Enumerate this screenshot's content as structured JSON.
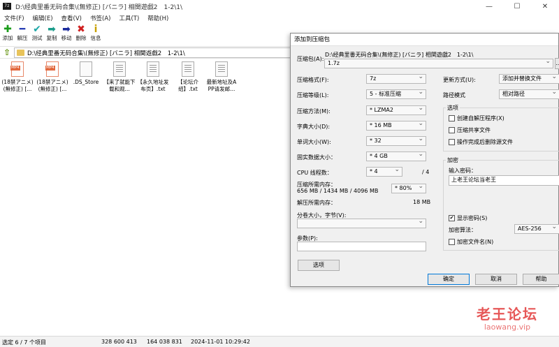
{
  "window": {
    "title": "D:\\经典里番无码合集\\(無修正) [バニラ] 相関遊戯2　1-2\\1\\",
    "app_icon": "7z",
    "minimize": "—",
    "maximize": "☐",
    "close": "✕"
  },
  "menu": [
    "文件(F)",
    "编辑(E)",
    "查看(V)",
    "书签(A)",
    "工具(T)",
    "帮助(H)"
  ],
  "toolbar": [
    {
      "label": "添加",
      "icon": "add-icon",
      "glyph": "✚",
      "color": "#1a9c1a"
    },
    {
      "label": "解压",
      "icon": "extract-icon",
      "glyph": "━",
      "color": "#2a3fb5"
    },
    {
      "label": "测试",
      "icon": "test-icon",
      "glyph": "✔",
      "color": "#1aa6a6"
    },
    {
      "label": "复制",
      "icon": "copy-icon",
      "glyph": "➡",
      "color": "#1a9c8a"
    },
    {
      "label": "移动",
      "icon": "move-icon",
      "glyph": "➡",
      "color": "#1a2a9c"
    },
    {
      "label": "删除",
      "icon": "delete-icon",
      "glyph": "✖",
      "color": "#d02020"
    },
    {
      "label": "信息",
      "icon": "info-icon",
      "glyph": "i",
      "color": "#c8a000"
    }
  ],
  "address": {
    "path": "D:\\经典里番无码合集\\(無修正) [バニラ] 相関遊戯2　1-2\\1\\"
  },
  "files": [
    {
      "name": "(18禁アニメ) (無修正) [...",
      "type": "mp4"
    },
    {
      "name": "(18禁アニメ) (無修正) [...",
      "type": "mp4"
    },
    {
      "name": ".DS_Store",
      "type": "blank"
    },
    {
      "name": "【来了就能下载和观...",
      "type": "txt"
    },
    {
      "name": "【永久地址发布页】.txt",
      "type": "txt"
    },
    {
      "name": "【论坛介绍】.txt",
      "type": "txt"
    },
    {
      "name": "最新地址及APP请发邮...",
      "type": "txt"
    }
  ],
  "file_type_label": "MP4",
  "status": {
    "selection": "选定 6 / 7 个项目",
    "size": "328 600 413",
    "packed": "164 038 831",
    "modified": "2024-11-01 10:29:42"
  },
  "dialog": {
    "title": "添加到压缩包",
    "archive_label": "压缩包(A):",
    "archive_dir": "D:\\经典里番无码合集\\(無修正) [バニラ] 相関遊戯2　1-2\\1\\",
    "archive_name": "1.7z",
    "browse": "...",
    "format_label": "压缩格式(F):",
    "format_value": "7z",
    "level_label": "压缩等级(L):",
    "level_value": "5 - 标准压缩",
    "method_label": "压缩方法(M):",
    "method_value": "* LZMA2",
    "dict_label": "字典大小(D):",
    "dict_value": "* 16 MB",
    "word_label": "单词大小(W):",
    "word_value": "* 32",
    "solid_label": "固实数据大小：",
    "solid_value": "* 4 GB",
    "threads_label": "CPU 线程数：",
    "threads_value": "* 4",
    "threads_max": "/ 4",
    "memcomp_label": "压缩所需内存：",
    "memcomp_value": "656 MB / 1434 MB / 4096 MB",
    "memcomp_percent": "* 80%",
    "memdecomp_label": "解压所需内存：",
    "memdecomp_value": "18 MB",
    "split_label": "分卷大小，字节(V):",
    "split_value": "",
    "params_label": "参数(P):",
    "params_value": "",
    "options_button": "选项",
    "update_label": "更新方式(U):",
    "update_value": "添加并替换文件",
    "pathmode_label": "路径模式",
    "pathmode_value": "相对路径",
    "options_group": "选项",
    "opt_sfx": "创建自解压程序(X)",
    "opt_shared": "压缩共享文件",
    "opt_delete": "操作完成后删除源文件",
    "encryption_group": "加密",
    "password_label": "输入密码：",
    "password_value": "上老王论坛当老王",
    "show_password": "显示密码(S)",
    "enc_method_label": "加密算法：",
    "enc_method_value": "AES-256",
    "encrypt_names": "加密文件名(N)",
    "ok": "确定",
    "cancel": "取消",
    "help": "帮助"
  },
  "watermark": {
    "title": "老王论坛",
    "url": "laowang.vip"
  }
}
